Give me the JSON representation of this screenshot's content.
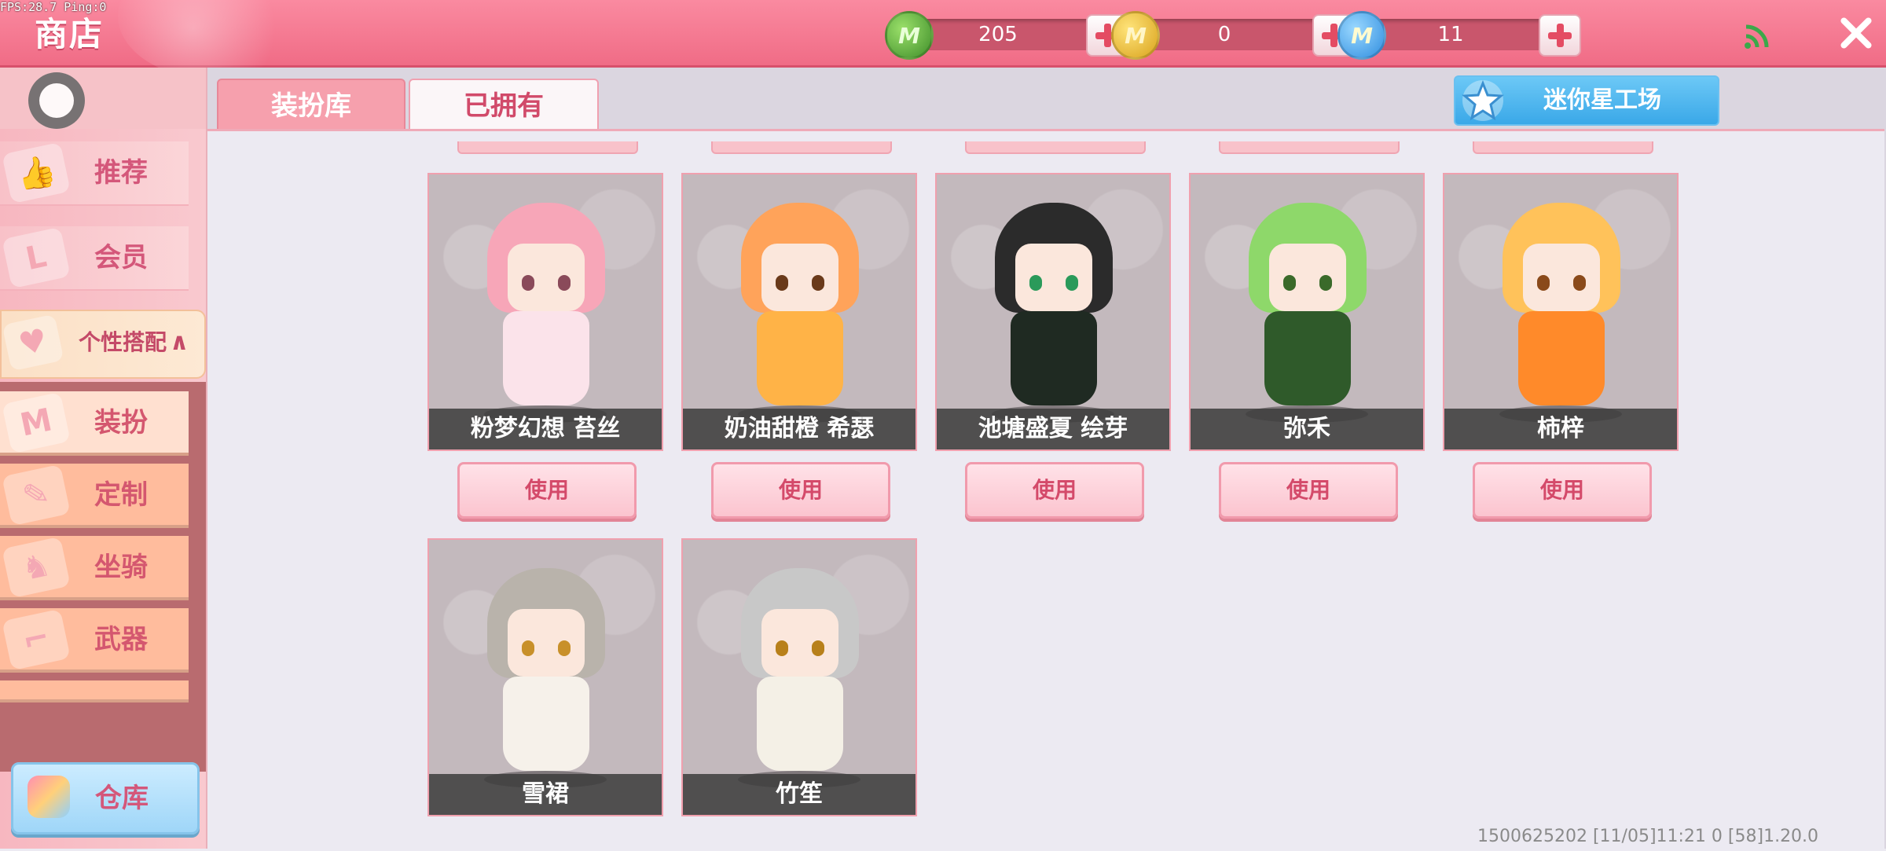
{
  "debug": {
    "fps": "FPS:28.7  Ping:0"
  },
  "header": {
    "title": "商店"
  },
  "currencies": [
    {
      "icon": "green-gem-coin-icon",
      "value": "205"
    },
    {
      "icon": "gold-coin-icon",
      "value": "0"
    },
    {
      "icon": "blue-coin-icon",
      "value": "11"
    }
  ],
  "sidebar": {
    "items": [
      {
        "label": "推荐",
        "icon": "thumbs-up-icon"
      },
      {
        "label": "会员",
        "icon": "vip-card-icon"
      }
    ],
    "group": {
      "label": "个性搭配",
      "icon": "heart-icon",
      "chevron": "∧"
    },
    "sub_items": [
      {
        "label": "装扮",
        "icon": "shirt-icon"
      },
      {
        "label": "定制",
        "icon": "brush-icon"
      },
      {
        "label": "坐骑",
        "icon": "mount-icon"
      },
      {
        "label": "武器",
        "icon": "gun-icon"
      }
    ],
    "warehouse": {
      "label": "仓库"
    }
  },
  "tabs": [
    {
      "label": "装扮库"
    },
    {
      "label": "已拥有"
    }
  ],
  "workshop": {
    "label": "迷你星工场"
  },
  "use_label": "使用",
  "outfits": [
    {
      "name": "粉梦幻想 苔丝",
      "hair": "#f7a6b8",
      "body": "#fbe3ea",
      "eye": "#8a4a5a"
    },
    {
      "name": "奶油甜橙 希瑟",
      "hair": "#ffa35a",
      "body": "#ffb347",
      "eye": "#6a3a1a"
    },
    {
      "name": "池塘盛夏 绘芽",
      "hair": "#2b2b2b",
      "body": "#1f2a22",
      "eye": "#2a9a5a"
    },
    {
      "name": "弥禾",
      "hair": "#8ed86a",
      "body": "#2f5a2a",
      "eye": "#3a6a2a"
    },
    {
      "name": "柿梓",
      "hair": "#ffc25a",
      "body": "#ff8a2a",
      "eye": "#8a4a1a"
    },
    {
      "name": "雪裙",
      "hair": "#b9b3ab",
      "body": "#f6f1ea",
      "eye": "#c8902a"
    },
    {
      "name": "竹笙",
      "hair": "#c8c8c8",
      "body": "#f4f0e6",
      "eye": "#b8801a"
    }
  ],
  "footer": {
    "text": "1500625202  [11/05]11:21 0     [58]1.20.0"
  }
}
